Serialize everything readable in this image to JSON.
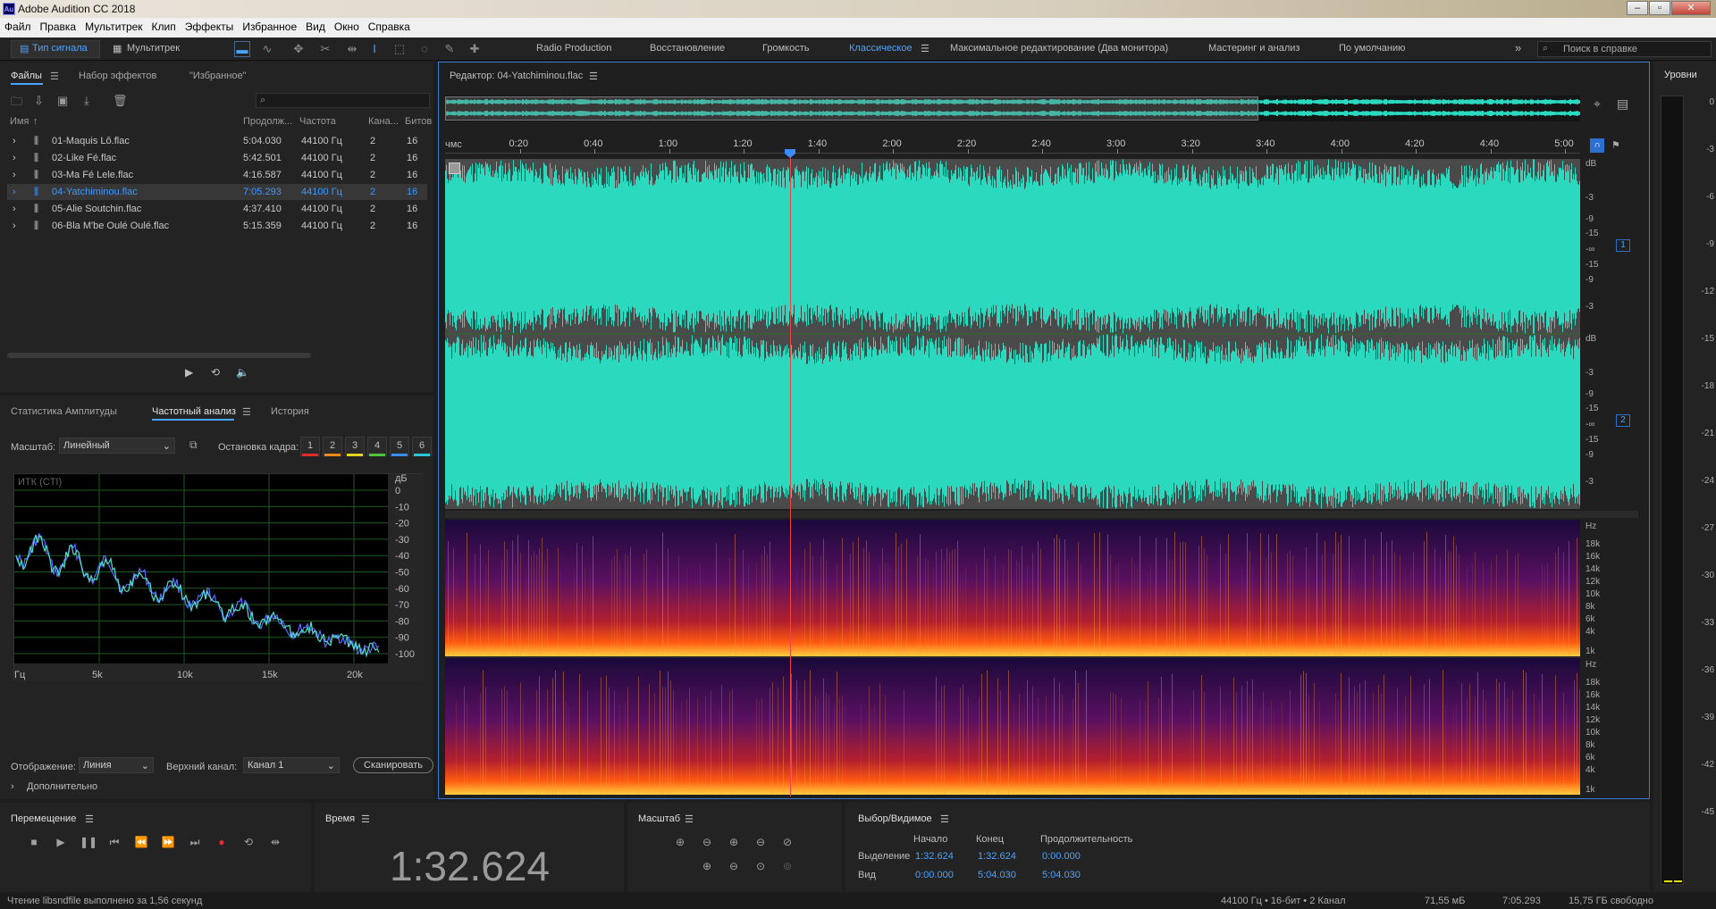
{
  "app": {
    "title": "Adobe Audition CC 2018",
    "logo_text": "Au"
  },
  "menu": [
    "Файл",
    "Правка",
    "Мультитрек",
    "Клип",
    "Эффекты",
    "Избранное",
    "Вид",
    "Окно",
    "Справка"
  ],
  "toolbar": {
    "mode_waveform": "Тип сигнала",
    "mode_multitrack": "Мультитрек",
    "workspaces": [
      "Radio Production",
      "Восстановление",
      "Громкость",
      "Классическое",
      "Максимальное редактирование (Два монитора)",
      "Мастеринг и анализ",
      "По умолчанию"
    ],
    "active_workspace": "Классическое",
    "search_placeholder": "Поиск в справке",
    "more": "»"
  },
  "files_panel": {
    "tabs": [
      "Файлы",
      "Набор эффектов",
      "\"Избранное\""
    ],
    "columns": [
      "Имя",
      "Продолж...",
      "Частота",
      "Кана...",
      "Битов"
    ],
    "files": [
      {
        "name": "01-Maquis Lô.flac",
        "duration": "5:04.030",
        "rate": "44100 Гц",
        "channels": "2",
        "bits": "16"
      },
      {
        "name": "02-Like Fé.flac",
        "duration": "5:42.501",
        "rate": "44100 Гц",
        "channels": "2",
        "bits": "16"
      },
      {
        "name": "03-Ma Fé Lele.flac",
        "duration": "4:16.587",
        "rate": "44100 Гц",
        "channels": "2",
        "bits": "16"
      },
      {
        "name": "04-Yatchiminou.flac",
        "duration": "7:05.293",
        "rate": "44100 Гц",
        "channels": "2",
        "bits": "16"
      },
      {
        "name": "05-Alie Soutchin.flac",
        "duration": "4:37.410",
        "rate": "44100 Гц",
        "channels": "2",
        "bits": "16"
      },
      {
        "name": "06-Bla M'be Oulé Oulé.flac",
        "duration": "5:15.359",
        "rate": "44100 Гц",
        "channels": "2",
        "bits": "16"
      }
    ]
  },
  "analysis_panel": {
    "tabs": [
      "Статистика Амплитуды",
      "Частотный анализ",
      "История"
    ],
    "scale_label": "Масштаб:",
    "scale_value": "Линейный",
    "freeze_label": "Остановка кадра:",
    "freeze_slots": [
      "1",
      "2",
      "3",
      "4",
      "5",
      "6"
    ],
    "freeze_colors": [
      "#e02b2b",
      "#ef8a16",
      "#e3d41e",
      "#4bc43b",
      "#3a8ef0",
      "#28c7d8"
    ],
    "graph_label": "ИТК (CTI)",
    "db_unit": "дБ",
    "db_ticks": [
      "0",
      "-10",
      "-20",
      "-30",
      "-40",
      "-50",
      "-60",
      "-70",
      "-80",
      "-90",
      "-100"
    ],
    "freq_ticks": [
      "Гц",
      "5k",
      "10k",
      "15k",
      "20k"
    ],
    "display_label": "Отображение:",
    "display_value": "Линия",
    "top_channel_label": "Верхний канал:",
    "top_channel_value": "Канал 1",
    "scan_button": "Сканировать",
    "advanced": "Дополнительно"
  },
  "editor": {
    "title": "Редактор: 04-Yatchiminou.flac",
    "time_unit": "чмс",
    "timeline": [
      "0:20",
      "0:40",
      "1:00",
      "1:20",
      "1:40",
      "2:00",
      "2:20",
      "2:40",
      "3:00",
      "3:20",
      "3:40",
      "4:00",
      "4:20",
      "4:40",
      "5:00"
    ],
    "db_ticks": [
      "dB",
      "-3",
      "-9",
      "-15",
      "-∞",
      "-15",
      "-9",
      "-3"
    ],
    "hz_ticks": [
      "Hz",
      "18k",
      "16k",
      "14k",
      "12k",
      "10k",
      "8k",
      "6k",
      "4k",
      "1k"
    ],
    "channels": [
      "1",
      "2"
    ],
    "waveform_color": "#2bd9bf"
  },
  "levels": {
    "title": "Уровни",
    "ticks": [
      "0",
      "-3",
      "-6",
      "-9",
      "-12",
      "-15",
      "-18",
      "-21",
      "-24",
      "-27",
      "-30",
      "-33",
      "-36",
      "-39",
      "-42",
      "-45"
    ]
  },
  "transport": {
    "title": "Перемещение"
  },
  "time": {
    "title": "Время",
    "value": "1:32.624"
  },
  "zoom": {
    "title": "Масштаб"
  },
  "selection": {
    "title": "Выбор/Видимое",
    "headers": [
      "Начало",
      "Конец",
      "Продолжительность"
    ],
    "rows": [
      {
        "label": "Выделение",
        "start": "1:32.624",
        "end": "1:32.624",
        "duration": "0:00.000"
      },
      {
        "label": "Вид",
        "start": "0:00.000",
        "end": "5:04.030",
        "duration": "5:04.030"
      }
    ]
  },
  "status": {
    "left": "Чтение libsndfile выполнено за 1,56 секунд",
    "format": "44100 Гц • 16-бит • 2 Канал",
    "size": "71,55 мБ",
    "duration": "7:05.293",
    "free": "15,75 ГБ свободно"
  }
}
